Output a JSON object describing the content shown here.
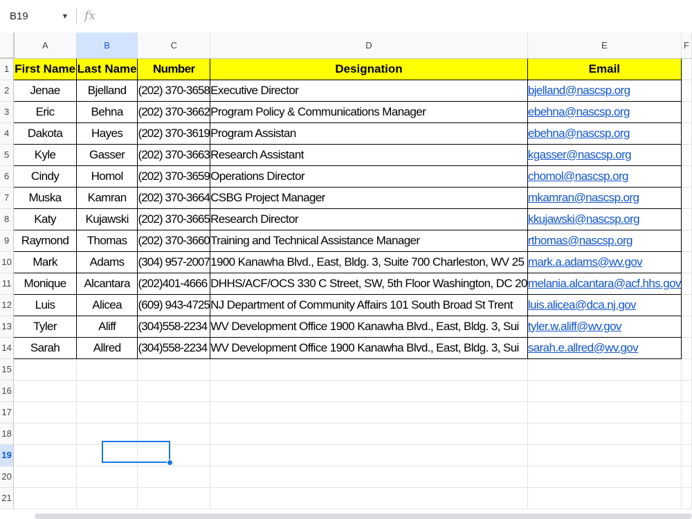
{
  "formula_bar": {
    "name_box": "B19",
    "dropdown_glyph": "▼",
    "fx_label": "fx",
    "formula_value": ""
  },
  "column_headers": [
    "A",
    "B",
    "C",
    "D",
    "E",
    "F"
  ],
  "selected_column": "B",
  "selected_row": 19,
  "selected_cell": "B19",
  "row_numbers": [
    "1",
    "2",
    "3",
    "4",
    "5",
    "6",
    "7",
    "8",
    "9",
    "10",
    "11",
    "12",
    "13",
    "14",
    "15",
    "16",
    "17",
    "18",
    "19",
    "20",
    "21"
  ],
  "table": {
    "header_fill_color": "#ffff00",
    "link_color": "#1155cc",
    "headers": [
      "First Name",
      "Last Name",
      "Number",
      "Designation",
      "Email"
    ],
    "rows": [
      [
        "Jenae",
        "Bjelland",
        "(202) 370-3658",
        "Executive Director",
        "bjelland@nascsp.org"
      ],
      [
        "Eric",
        "Behna",
        "(202) 370-3662",
        "Program Policy & Communications Manager",
        "ebehna@nascsp.org"
      ],
      [
        "Dakota",
        "Hayes",
        "(202) 370-3619",
        "Program Assistan",
        "ebehna@nascsp.org"
      ],
      [
        "Kyle",
        "Gasser",
        "(202) 370-3663",
        "Research Assistant",
        "kgasser@nascsp.org"
      ],
      [
        "Cindy",
        "Homol",
        "(202) 370-3659",
        "Operations Director",
        "chomol@nascsp.org"
      ],
      [
        "Muska",
        "Kamran",
        "(202) 370-3664",
        "CSBG Project Manager",
        "mkamran@nascsp.org"
      ],
      [
        "Katy",
        "Kujawski",
        "(202) 370-3665",
        "Research Director",
        "kkujawski@nascsp.org"
      ],
      [
        "Raymond",
        "Thomas",
        "(202) 370-3660",
        "Training and Technical Assistance Manager",
        "rthomas@nascsp.org"
      ],
      [
        "Mark",
        "Adams",
        "(304) 957-2007",
        "1900 Kanawha Blvd., East, Bldg. 3, Suite 700 Charleston, WV 25",
        "mark.a.adams@wv.gov"
      ],
      [
        "Monique",
        "Alcantara",
        "(202)401-4666",
        "DHHS/ACF/OCS 330 C Street, SW, 5th Floor Washington, DC 20",
        "melania.alcantara@acf.hhs.gov"
      ],
      [
        "Luis",
        "Alicea",
        "(609) 943-4725",
        "NJ Department of Community Affairs 101 South Broad St Trent",
        "luis.alicea@dca.nj.gov"
      ],
      [
        "Tyler",
        "Aliff",
        "(304)558-2234",
        "WV Development Office 1900 Kanawha Blvd., East, Bldg. 3, Sui",
        "tyler.w.aliff@wv.gov"
      ],
      [
        "Sarah",
        "Allred",
        "(304)558-2234",
        "WV Development Office 1900 Kanawha Blvd., East, Bldg. 3, Sui",
        "sarah.e.allred@wv.gov"
      ]
    ]
  }
}
